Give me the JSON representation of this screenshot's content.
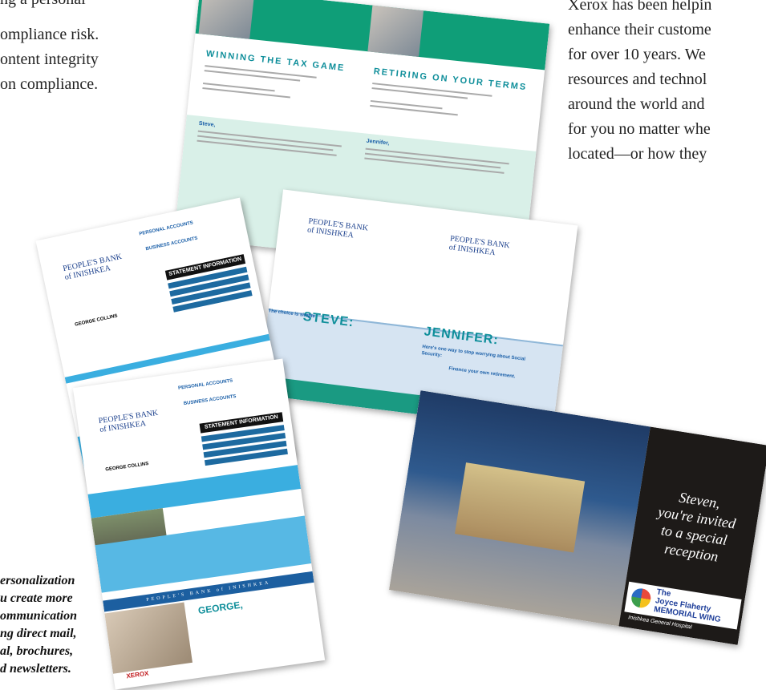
{
  "left_text": [
    "ng a personal",
    "ompliance risk.",
    "ontent integrity",
    "on compliance."
  ],
  "right_text": [
    "Xerox has been helpin",
    "enhance their custome",
    "for over 10 years. We",
    "resources and technol",
    "around the world and",
    "for you no matter whe",
    "located—or how they"
  ],
  "caption": [
    "ersonalization",
    "u create more",
    "ommunication",
    "ng direct mail,",
    "al, brochures,",
    "d newsletters."
  ],
  "flyer": {
    "left_heading": "WINNING THE TAX GAME",
    "right_heading": "RETIRING ON YOUR TERMS",
    "left_name": "Steve,",
    "right_name": "Jennifer,"
  },
  "bank": {
    "name_line1": "PEOPLE'S BANK",
    "name_line2": "of INISHKEA",
    "personal_accounts": "PERSONAL ACCOUNTS",
    "business_accounts": "BUSINESS ACCOUNTS",
    "statement_info": "STATEMENT INFORMATION",
    "customer": "GEORGE COLLINS",
    "xerox": "XEROX"
  },
  "mailer": {
    "steve": "STEVE:",
    "jennifer": "JENNIFER:",
    "steve_tag": "The choice is simple",
    "jennifer_tag": "Here's one way to stop worrying about Social Security:",
    "cta": "Finance your own retirement."
  },
  "letter2": {
    "footer_bank": "PEOPLE'S BANK of INISHKEA",
    "george": "GEORGE,"
  },
  "invite": {
    "script": [
      "Steven,",
      "you're invited",
      "to a special",
      "reception"
    ],
    "wing_the": "The",
    "wing_name": "Joyce Flaherty",
    "wing_sub": "MEMORIAL WING",
    "hospital": "Inishkea General Hospital"
  }
}
